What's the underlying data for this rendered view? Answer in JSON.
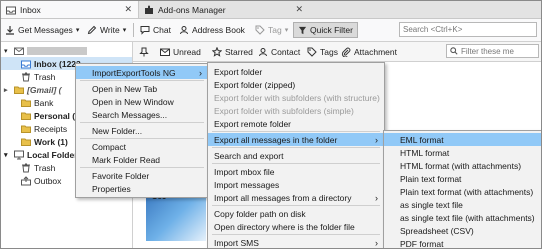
{
  "tabs": [
    {
      "label": "Inbox"
    },
    {
      "label": "Add-ons Manager"
    }
  ],
  "toolbar": {
    "get_messages": "Get Messages",
    "write": "Write",
    "chat": "Chat",
    "address_book": "Address Book",
    "tag": "Tag",
    "quick_filter": "Quick Filter",
    "search_placeholder": "Search <Ctrl+K>"
  },
  "quick_filter_bar": {
    "unread": "Unread",
    "starred": "Starred",
    "contact": "Contact",
    "tags": "Tags",
    "attachment": "Attachment",
    "filter_placeholder": "Filter these me"
  },
  "folders": [
    {
      "label": "Inbox (1223"
    },
    {
      "label": "Trash"
    },
    {
      "label": "[Gmail] ("
    },
    {
      "label": "Bank"
    },
    {
      "label": "Personal (5"
    },
    {
      "label": "Receipts"
    },
    {
      "label": "Work (1)"
    },
    {
      "label": "Local Folders"
    },
    {
      "label": "Trash"
    },
    {
      "label": "Outbox"
    }
  ],
  "context_menu": [
    {
      "label": "ImportExportTools NG",
      "has_submenu": true
    },
    {
      "label": "Open in New Tab"
    },
    {
      "label": "Open in New Window"
    },
    {
      "label": "Search Messages..."
    },
    {
      "label": "New Folder..."
    },
    {
      "label": "Compact"
    },
    {
      "label": "Mark Folder Read"
    },
    {
      "label": "Favorite Folder"
    },
    {
      "label": "Properties"
    }
  ],
  "submenu1": [
    {
      "label": "Export folder"
    },
    {
      "label": "Export folder (zipped)"
    },
    {
      "label": "Export folder with subfolders (with structure)"
    },
    {
      "label": "Export folder with subfolders (simple)"
    },
    {
      "label": "Export remote folder"
    },
    {
      "label": "Export all messages in the folder",
      "has_submenu": true
    },
    {
      "label": "Search and export"
    },
    {
      "label": "Import mbox file"
    },
    {
      "label": "Import messages"
    },
    {
      "label": "Import all messages from a directory",
      "has_submenu": true
    },
    {
      "label": "Copy folder path on disk"
    },
    {
      "label": "Open directory where is the folder file"
    },
    {
      "label": "Import SMS",
      "has_submenu": true
    }
  ],
  "submenu2": [
    {
      "label": "EML format"
    },
    {
      "label": "HTML format"
    },
    {
      "label": "HTML format (with attachments)"
    },
    {
      "label": "Plain text format"
    },
    {
      "label": "Plain text format (with attachments)"
    },
    {
      "label": "as single text file"
    },
    {
      "label": "as single text file (with attachments)"
    },
    {
      "label": "Spreadsheet (CSV)"
    },
    {
      "label": "PDF format"
    }
  ],
  "message_area": {
    "partial_text": "Sec"
  }
}
